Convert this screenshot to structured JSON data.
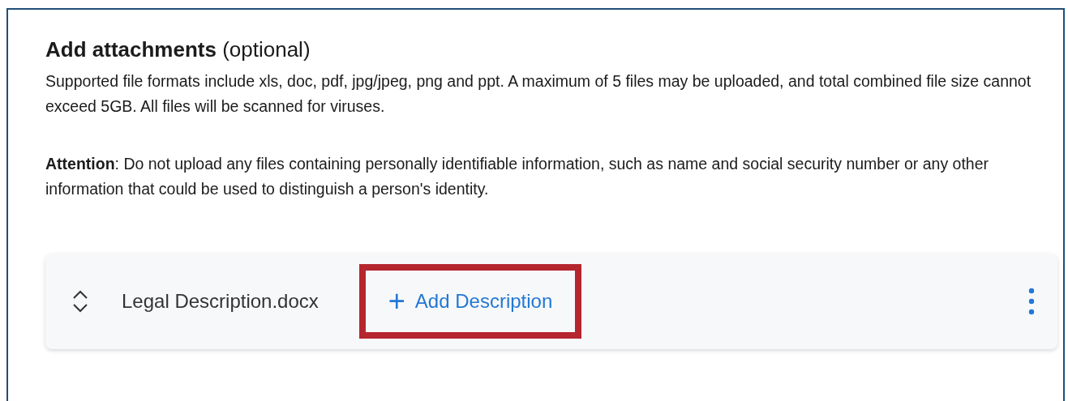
{
  "section": {
    "title": "**Add attachments** (optional)",
    "description": "Supported file formats include xls, doc, pdf, jpg/jpeg, png and ppt. A maximum of 5 files may be uploaded, and total combined file size cannot exceed 5GB. All files will be scanned for viruses.",
    "attention": "**Attention**: Do not upload any files containing personally identifiable information, such as name and social security number or any other information that could be used to distinguish a person's identity."
  },
  "files": [
    {
      "name": "Legal Description.docx",
      "action": {
        "icon": "+",
        "label": "Add Description",
        "highlighted": true
      }
    }
  ]
}
